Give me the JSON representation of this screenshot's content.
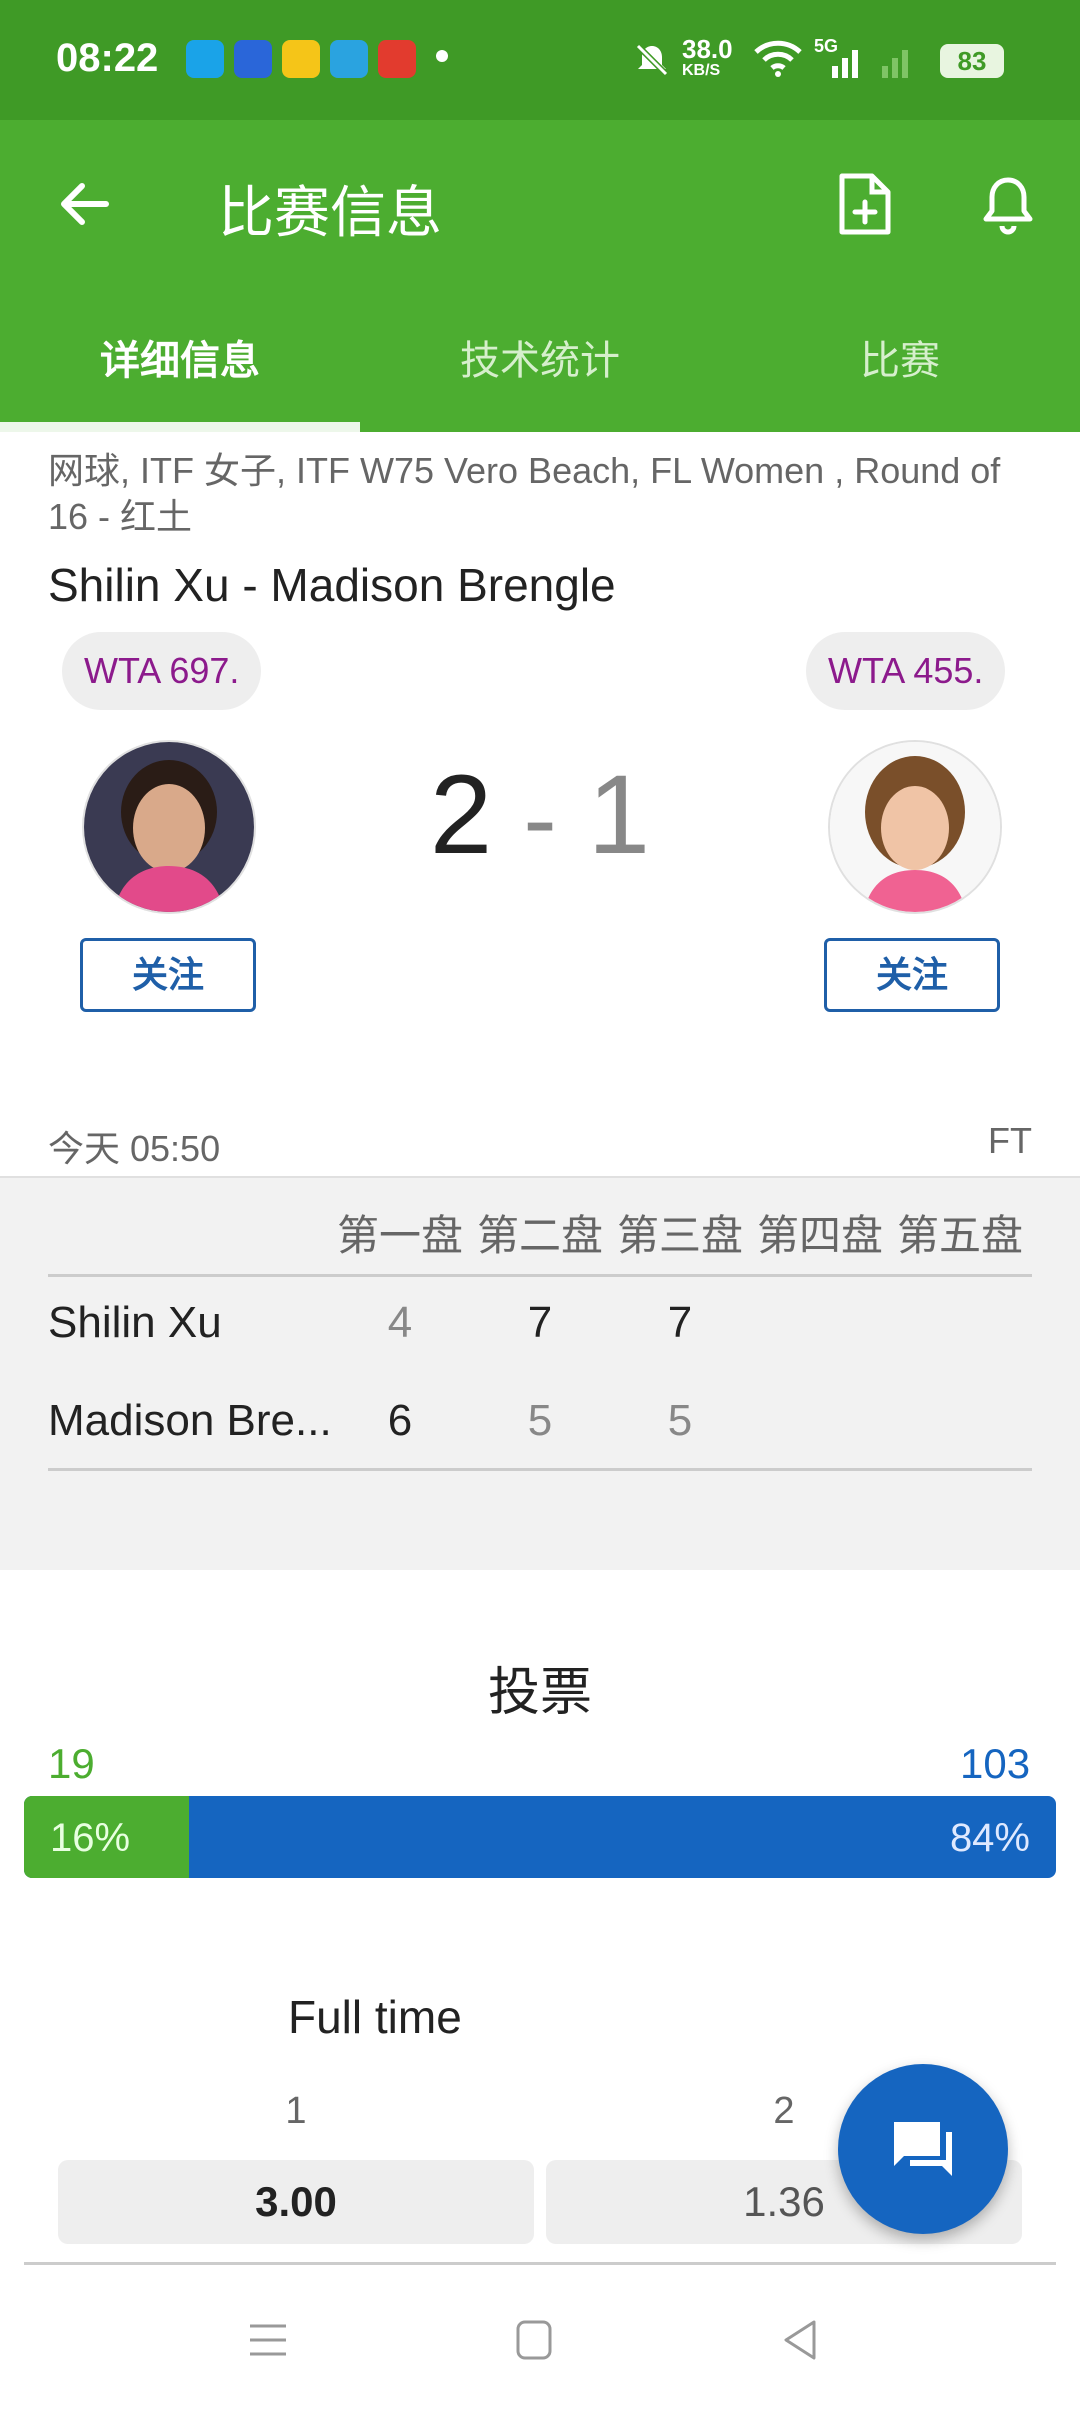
{
  "status_bar": {
    "time": "08:22",
    "network_speed": "38.0",
    "network_speed_unit": "KB/S",
    "network_type": "5G",
    "battery": "83",
    "icons": [
      "app-notification-icon",
      "mute-icon",
      "wifi-icon",
      "signal-icon"
    ]
  },
  "app_bar": {
    "title": "比赛信息",
    "tabs": [
      {
        "label": "详细信息",
        "active": true
      },
      {
        "label": "技术统计",
        "active": false
      },
      {
        "label": "比赛",
        "active": false
      }
    ]
  },
  "match": {
    "breadcrumb": "网球, ITF 女子, ITF W75 Vero Beach, FL Women , Round of 16 - 红土",
    "title": "Shilin Xu - Madison Brengle",
    "home": {
      "rank": "WTA 697.",
      "follow_label": "关注"
    },
    "away": {
      "rank": "WTA 455.",
      "follow_label": "关注"
    },
    "score_home": "2",
    "score_sep": "-",
    "score_away": "1",
    "date": "今天 05:50",
    "status": "FT"
  },
  "sets": {
    "headers": [
      "第一盘",
      "第二盘",
      "第三盘",
      "第四盘",
      "第五盘"
    ],
    "rows": [
      {
        "name": "Shilin Xu",
        "scores": [
          "4",
          "7",
          "7"
        ]
      },
      {
        "name": "Madison Bre...",
        "scores": [
          "6",
          "5",
          "5"
        ]
      }
    ]
  },
  "votes": {
    "title": "投票",
    "home_count": "19",
    "away_count": "103",
    "home_pct": "16%",
    "away_pct": "84%",
    "home_fraction": 0.16,
    "colors": {
      "home": "#4cad30",
      "away": "#1565c0"
    }
  },
  "odds": {
    "title": "Full time",
    "headers": [
      "1",
      "2"
    ],
    "values": [
      "3.00",
      "1.36"
    ]
  },
  "colors": {
    "accent": "#4cad30",
    "statusbar": "#3f9a26",
    "link": "#1f5fa8"
  }
}
